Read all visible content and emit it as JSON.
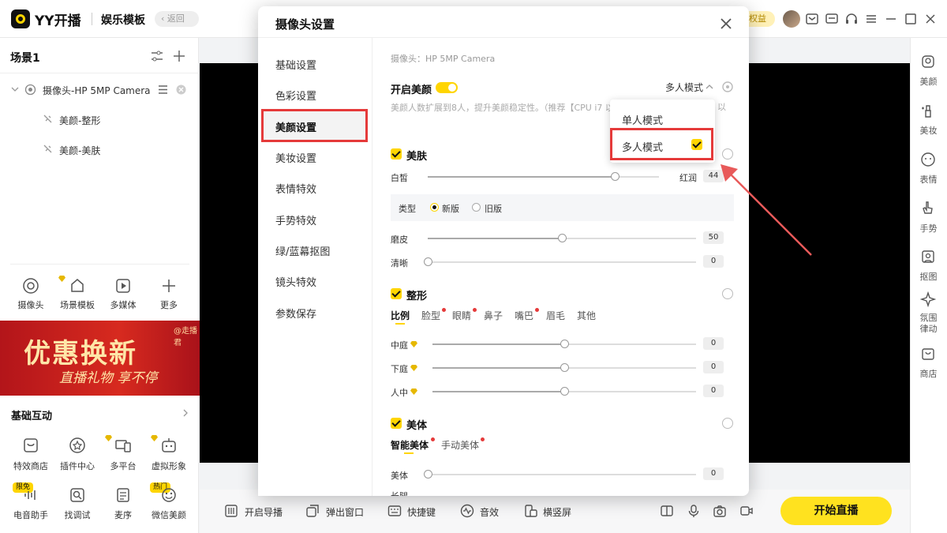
{
  "topbar": {
    "brand": "YY开播",
    "template": "娱乐模板",
    "back": "返回",
    "benefit": "权益"
  },
  "left": {
    "scene_title": "场景1",
    "source": "摄像头-HP 5MP Camera",
    "children": [
      "美颜-整形",
      "美颜-美肤"
    ],
    "tools": [
      "摄像头",
      "场景模板",
      "多媒体",
      "更多"
    ],
    "banner": {
      "line1": "优惠换新",
      "line2": "直播礼物 享不停",
      "tag": "@走播君"
    },
    "interact_title": "基础互动",
    "interact": [
      "特效商店",
      "插件中心",
      "多平台",
      "虚拟形象",
      "电音助手",
      "找调试",
      "麦序",
      "微信美颜"
    ],
    "badges": {
      "limited": "限免",
      "hot": "热门"
    }
  },
  "rail": [
    "美颜",
    "美妆",
    "表情",
    "手势",
    "抠图",
    "氛围律动",
    "商店"
  ],
  "bottom": {
    "items": [
      "开启导播",
      "弹出窗口",
      "快捷键",
      "音效",
      "横竖屏"
    ],
    "start": "开始直播"
  },
  "modal": {
    "title": "摄像头设置",
    "menu": [
      "基础设置",
      "色彩设置",
      "美颜设置",
      "美妆设置",
      "表情特效",
      "手势特效",
      "绿/蓝幕抠图",
      "镜头特效",
      "参数保存"
    ],
    "active": "美颜设置",
    "camera": "摄像头：HP 5MP Camera",
    "enable": "开启美颜",
    "mode": "多人模式",
    "hint": "美颜人数扩展到8人，提升美颜稳定性。（推荐【CPU i7 以上设备开启）",
    "hint_tail": "以",
    "skin": {
      "title": "美肤",
      "white": "白皙",
      "ruddy": "红润",
      "value": "44",
      "type_label": "类型",
      "new": "新版",
      "old": "旧版",
      "smooth": "磨皮",
      "smooth_val": "50",
      "clear": "清晰",
      "clear_val": "0",
      "white_level": 0.81,
      "smooth_level": 0.5,
      "clear_level": 0
    },
    "shape": {
      "title": "整形",
      "tabs": [
        "比例",
        "脸型",
        "眼睛",
        "鼻子",
        "嘴巴",
        "眉毛",
        "其他"
      ],
      "rows": [
        {
          "label": "中庭",
          "val": "0",
          "level": 0.5
        },
        {
          "label": "下庭",
          "val": "0",
          "level": 0.5
        },
        {
          "label": "人中",
          "val": "0",
          "level": 0.5
        }
      ]
    },
    "body": {
      "title": "美体",
      "tabs": [
        "智能美体",
        "手动美体"
      ],
      "row": "美体",
      "row_val": "0",
      "row_level": 0,
      "next": "长腿"
    },
    "dropdown": [
      "单人模式",
      "多人模式"
    ]
  },
  "colors": {
    "accent": "#ffd500",
    "highlight": "#e53a3a"
  }
}
